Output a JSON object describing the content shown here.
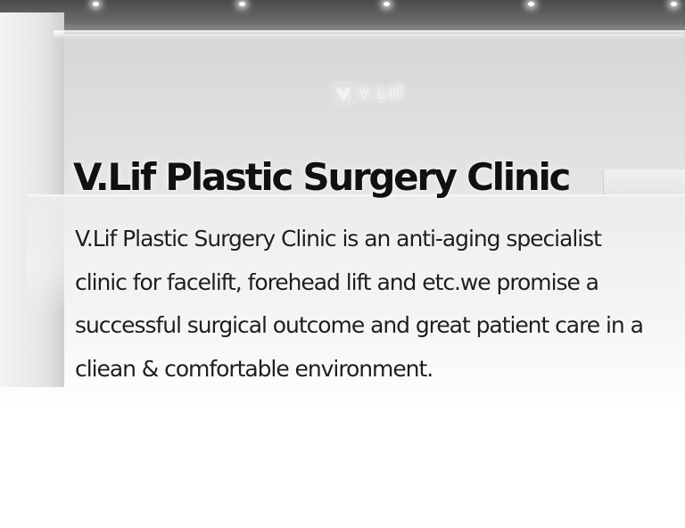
{
  "background_photo": {
    "sign": {
      "brand": "V.LIF",
      "icon": "v-lif-logo-mark"
    }
  },
  "intro": {
    "title": "V.Lif Plastic Surgery Clinic",
    "description": "V.Lif Plastic Surgery Clinic is an anti-aging specialist clinic for facelift, forehead lift and etc.we promise a successful surgical outcome and great patient care in a cliean & comfortable environment."
  },
  "colors": {
    "title_text": "#111111",
    "body_text": "#1e1e1e",
    "wall": "#dedede",
    "ceiling": "#4a4a4a"
  }
}
